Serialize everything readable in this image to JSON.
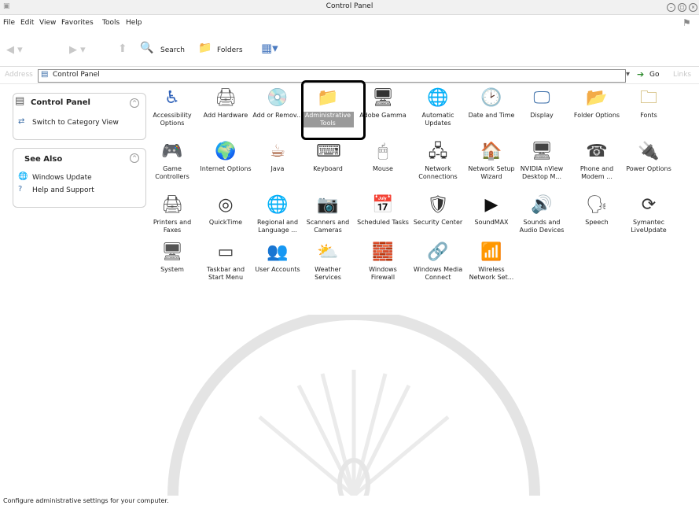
{
  "window": {
    "title": "Control Panel"
  },
  "menubar": {
    "items": [
      "File",
      "Edit",
      "View",
      "Favorites",
      "Tools",
      "Help"
    ]
  },
  "toolbar": {
    "search": "Search",
    "folders": "Folders"
  },
  "address": {
    "label": "Address",
    "value": "Control Panel",
    "go": "Go",
    "links": "Links"
  },
  "sidebar": {
    "panel_title": "Control Panel",
    "switch_view": "Switch to Category View",
    "see_also_title": "See Also",
    "see_also": [
      "Windows Update",
      "Help and Support"
    ]
  },
  "items": [
    {
      "label": "Accessibility Options",
      "icon": "accessibility-icon",
      "glyph": "♿",
      "color": "#2b5fb8"
    },
    {
      "label": "Add Hardware",
      "icon": "hardware-icon",
      "glyph": "🖨",
      "color": "#666"
    },
    {
      "label": "Add or Remov...",
      "icon": "programs-icon",
      "glyph": "💿",
      "color": "#8a6a2a"
    },
    {
      "label": "Administrative Tools",
      "icon": "admin-tools-icon",
      "glyph": "📁",
      "color": "#7a6a3a"
    },
    {
      "label": "Adobe Gamma",
      "icon": "adobe-gamma-icon",
      "glyph": "🖥",
      "color": "#333"
    },
    {
      "label": "Automatic Updates",
      "icon": "globe-icon",
      "glyph": "🌐",
      "color": "#1a5fa8"
    },
    {
      "label": "Date and Time",
      "icon": "clock-icon",
      "glyph": "🕑",
      "color": "#555"
    },
    {
      "label": "Display",
      "icon": "display-icon",
      "glyph": "🖵",
      "color": "#3b6ea8"
    },
    {
      "label": "Folder Options",
      "icon": "folder-options-icon",
      "glyph": "📂",
      "color": "#b8962e"
    },
    {
      "label": "Fonts",
      "icon": "fonts-icon",
      "glyph": "🗀",
      "color": "#b8962e"
    },
    {
      "label": "Game Controllers",
      "icon": "gamepad-icon",
      "glyph": "🎮",
      "color": "#555"
    },
    {
      "label": "Internet Options",
      "icon": "internet-icon",
      "glyph": "🌍",
      "color": "#1a5fa8"
    },
    {
      "label": "Java",
      "icon": "java-icon",
      "glyph": "☕",
      "color": "#a0522d"
    },
    {
      "label": "Keyboard",
      "icon": "keyboard-icon",
      "glyph": "⌨",
      "color": "#444"
    },
    {
      "label": "Mouse",
      "icon": "mouse-icon",
      "glyph": "🖱",
      "color": "#777"
    },
    {
      "label": "Network Connections",
      "icon": "network-icon",
      "glyph": "🖧",
      "color": "#333"
    },
    {
      "label": "Network Setup Wizard",
      "icon": "home-network-icon",
      "glyph": "🏠",
      "color": "#555"
    },
    {
      "label": "NVIDIA nView Desktop M...",
      "icon": "nvidia-icon",
      "glyph": "🖥",
      "color": "#444"
    },
    {
      "label": "Phone and Modem ...",
      "icon": "phone-icon",
      "glyph": "☎",
      "color": "#444"
    },
    {
      "label": "Power Options",
      "icon": "power-icon",
      "glyph": "🔌",
      "color": "#555"
    },
    {
      "label": "Printers and Faxes",
      "icon": "printer-icon",
      "glyph": "🖨",
      "color": "#555"
    },
    {
      "label": "QuickTime",
      "icon": "quicktime-icon",
      "glyph": "◎",
      "color": "#333"
    },
    {
      "label": "Regional and Language ...",
      "icon": "regional-icon",
      "glyph": "🌐",
      "color": "#333"
    },
    {
      "label": "Scanners and Cameras",
      "icon": "scanner-icon",
      "glyph": "📷",
      "color": "#555"
    },
    {
      "label": "Scheduled Tasks",
      "icon": "scheduled-tasks-icon",
      "glyph": "📅",
      "color": "#777"
    },
    {
      "label": "Security Center",
      "icon": "shield-icon",
      "glyph": "🛡",
      "color": "#333"
    },
    {
      "label": "SoundMAX",
      "icon": "soundmax-icon",
      "glyph": "▶",
      "color": "#111"
    },
    {
      "label": "Sounds and Audio Devices",
      "icon": "speaker-icon",
      "glyph": "🔊",
      "color": "#444"
    },
    {
      "label": "Speech",
      "icon": "speech-icon",
      "glyph": "🗣",
      "color": "#555"
    },
    {
      "label": "Symantec LiveUpdate",
      "icon": "symantec-icon",
      "glyph": "⟳",
      "color": "#333"
    },
    {
      "label": "System",
      "icon": "system-icon",
      "glyph": "🖥",
      "color": "#555"
    },
    {
      "label": "Taskbar and Start Menu",
      "icon": "taskbar-icon",
      "glyph": "▭",
      "color": "#333"
    },
    {
      "label": "User Accounts",
      "icon": "users-icon",
      "glyph": "👥",
      "color": "#333"
    },
    {
      "label": "Weather Services",
      "icon": "weather-icon",
      "glyph": "⛅",
      "color": "#222"
    },
    {
      "label": "Windows Firewall",
      "icon": "firewall-icon",
      "glyph": "🧱",
      "color": "#8b3a2a"
    },
    {
      "label": "Windows Media Connect",
      "icon": "media-connect-icon",
      "glyph": "🔗",
      "color": "#555"
    },
    {
      "label": "Wireless Network Set...",
      "icon": "wireless-icon",
      "glyph": "📶",
      "color": "#555"
    }
  ],
  "selected_index": 3,
  "status": {
    "text": "Configure administrative settings for your computer."
  }
}
